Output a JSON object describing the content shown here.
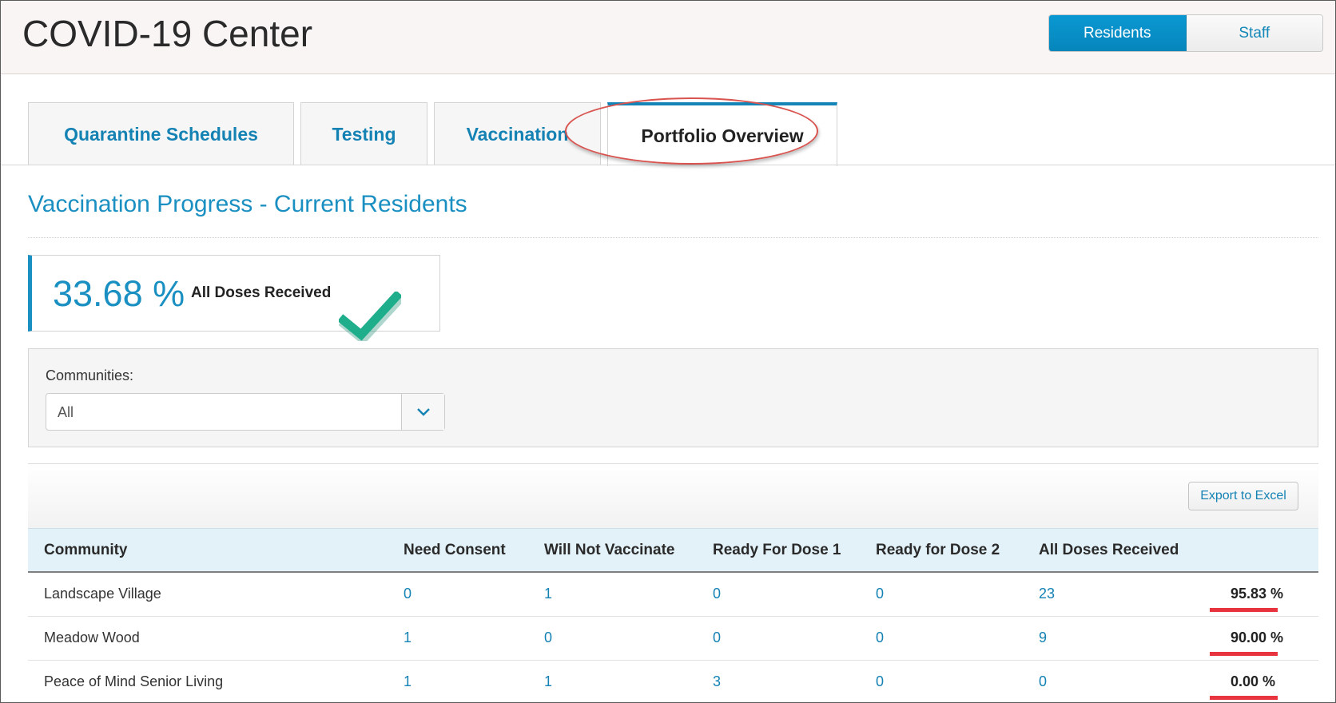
{
  "header": {
    "title": "COVID-19 Center",
    "toggle": [
      {
        "label": "Residents",
        "active": true
      },
      {
        "label": "Staff",
        "active": false
      }
    ]
  },
  "tabs": [
    {
      "label": "Quarantine Schedules",
      "active": false
    },
    {
      "label": "Testing",
      "active": false
    },
    {
      "label": "Vaccination",
      "active": false
    },
    {
      "label": "Portfolio Overview",
      "active": true
    }
  ],
  "section": {
    "title": "Vaccination Progress - Current Residents"
  },
  "summary": {
    "value": "33.68 %",
    "label": "All Doses Received"
  },
  "filter": {
    "label": "Communities:",
    "selected": "All"
  },
  "grid": {
    "export_label": "Export to Excel",
    "columns": [
      "Community",
      "Need Consent",
      "Will Not Vaccinate",
      "Ready For Dose 1",
      "Ready for Dose 2",
      "All Doses Received"
    ],
    "rows": [
      {
        "community": "Landscape Village",
        "need_consent": "0",
        "will_not_vaccinate": "1",
        "ready_dose_1": "0",
        "ready_dose_2": "0",
        "all_doses": "23",
        "pct": "95.83 %"
      },
      {
        "community": "Meadow Wood",
        "need_consent": "1",
        "will_not_vaccinate": "0",
        "ready_dose_1": "0",
        "ready_dose_2": "0",
        "all_doses": "9",
        "pct": "90.00 %"
      },
      {
        "community": "Peace of Mind Senior Living",
        "need_consent": "1",
        "will_not_vaccinate": "1",
        "ready_dose_1": "3",
        "ready_dose_2": "0",
        "all_doses": "0",
        "pct": "0.00 %"
      }
    ]
  },
  "colors": {
    "accent": "#1a8fc1",
    "annotation_red": "#d9534f",
    "checkmark": "#1fae8c"
  }
}
